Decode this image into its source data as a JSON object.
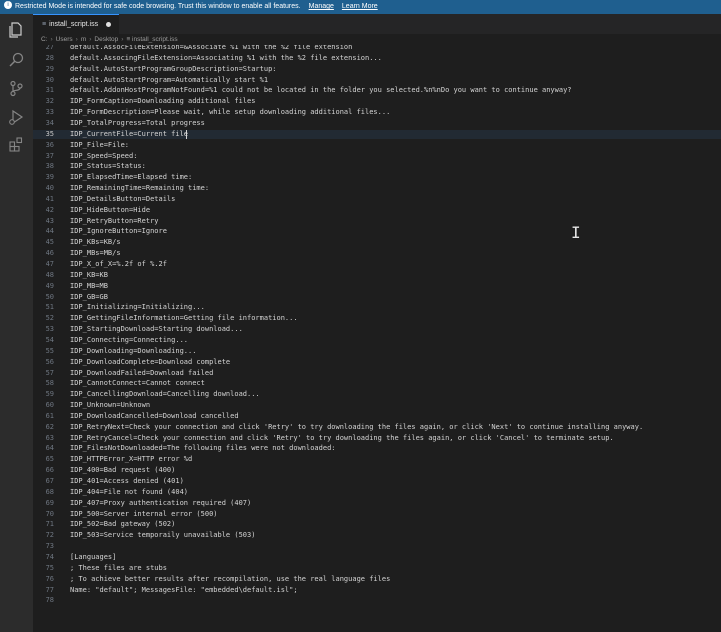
{
  "banner": {
    "message": "Restricted Mode is intended for safe code browsing. Trust this window to enable all features.",
    "manage": "Manage",
    "learn_more": "Learn More"
  },
  "activity_bar": [
    "explorer-icon",
    "search-icon",
    "source-control-icon",
    "run-debug-icon",
    "extensions-icon"
  ],
  "tab": {
    "title": "install_script.iss",
    "icon": "≡"
  },
  "breadcrumb": [
    "C:",
    "Users",
    "m",
    "Desktop",
    "≡ install_script.iss"
  ],
  "editor": {
    "current_line": 35,
    "lines": [
      {
        "n": "27",
        "t": "default.AssocFileExtension=&Associate %1 with the %2 file extension"
      },
      {
        "n": "28",
        "t": "default.AssocingFileExtension=Associating %1 with the %2 file extension..."
      },
      {
        "n": "29",
        "t": "default.AutoStartProgramGroupDescription=Startup:"
      },
      {
        "n": "30",
        "t": "default.AutoStartProgram=Automatically start %1"
      },
      {
        "n": "31",
        "t": "default.AddonHostProgramNotFound=%1 could not be located in the folder you selected.%n%nDo you want to continue anyway?"
      },
      {
        "n": "32",
        "t": "IDP_FormCaption=Downloading additional files"
      },
      {
        "n": "33",
        "t": "IDP_FormDescription=Please wait, while setup downloading additional files..."
      },
      {
        "n": "34",
        "t": "IDP_TotalProgress=Total progress"
      },
      {
        "n": "35",
        "t": "IDP_CurrentFile=Current file"
      },
      {
        "n": "36",
        "t": "IDP_File=File:"
      },
      {
        "n": "37",
        "t": "IDP_Speed=Speed:"
      },
      {
        "n": "38",
        "t": "IDP_Status=Status:"
      },
      {
        "n": "39",
        "t": "IDP_ElapsedTime=Elapsed time:"
      },
      {
        "n": "40",
        "t": "IDP_RemainingTime=Remaining time:"
      },
      {
        "n": "41",
        "t": "IDP_DetailsButton=Details"
      },
      {
        "n": "42",
        "t": "IDP_HideButton=Hide"
      },
      {
        "n": "43",
        "t": "IDP_RetryButton=Retry"
      },
      {
        "n": "44",
        "t": "IDP_IgnoreButton=Ignore"
      },
      {
        "n": "45",
        "t": "IDP_KBs=KB/s"
      },
      {
        "n": "46",
        "t": "IDP_MBs=MB/s"
      },
      {
        "n": "47",
        "t": "IDP_X_of_X=%.2f of %.2f"
      },
      {
        "n": "48",
        "t": "IDP_KB=KB"
      },
      {
        "n": "49",
        "t": "IDP_MB=MB"
      },
      {
        "n": "50",
        "t": "IDP_GB=GB"
      },
      {
        "n": "51",
        "t": "IDP_Initializing=Initializing..."
      },
      {
        "n": "52",
        "t": "IDP_GettingFileInformation=Getting file information..."
      },
      {
        "n": "53",
        "t": "IDP_StartingDownload=Starting download..."
      },
      {
        "n": "54",
        "t": "IDP_Connecting=Connecting..."
      },
      {
        "n": "55",
        "t": "IDP_Downloading=Downloading..."
      },
      {
        "n": "56",
        "t": "IDP_DownloadComplete=Download complete"
      },
      {
        "n": "57",
        "t": "IDP_DownloadFailed=Download failed"
      },
      {
        "n": "58",
        "t": "IDP_CannotConnect=Cannot connect"
      },
      {
        "n": "59",
        "t": "IDP_CancellingDownload=Cancelling download..."
      },
      {
        "n": "60",
        "t": "IDP_Unknown=Unknown"
      },
      {
        "n": "61",
        "t": "IDP_DownloadCancelled=Download cancelled"
      },
      {
        "n": "62",
        "t": "IDP_RetryNext=Check your connection and click 'Retry' to try downloading the files again, or click 'Next' to continue installing anyway."
      },
      {
        "n": "63",
        "t": "IDP_RetryCancel=Check your connection and click 'Retry' to try downloading the files again, or click 'Cancel' to terminate setup."
      },
      {
        "n": "64",
        "t": "IDP_FilesNotDownloaded=The following files were not downloaded:"
      },
      {
        "n": "65",
        "t": "IDP_HTTPError_X=HTTP error %d"
      },
      {
        "n": "66",
        "t": "IDP_400=Bad request (400)"
      },
      {
        "n": "67",
        "t": "IDP_401=Access denied (401)"
      },
      {
        "n": "68",
        "t": "IDP_404=File not found (404)"
      },
      {
        "n": "69",
        "t": "IDP_407=Proxy authentication required (407)"
      },
      {
        "n": "70",
        "t": "IDP_500=Server internal error (500)"
      },
      {
        "n": "71",
        "t": "IDP_502=Bad gateway (502)"
      },
      {
        "n": "72",
        "t": "IDP_503=Service temporaily unavailable (503)"
      },
      {
        "n": "73",
        "t": ""
      },
      {
        "n": "74",
        "t": "[Languages]"
      },
      {
        "n": "75",
        "t": "; These files are stubs"
      },
      {
        "n": "76",
        "t": "; To achieve better results after recompilation, use the real language files"
      },
      {
        "n": "77",
        "t": "Name: \"default\"; MessagesFile: \"embedded\\default.isl\";"
      },
      {
        "n": "78",
        "t": ""
      }
    ]
  },
  "colors": {
    "banner": "#1f5f8f",
    "editor_bg": "#1e1e1e",
    "activity_bar": "#2c2c2c",
    "tab_accent": "#3794ff",
    "text": "#d4d4d4",
    "line_number": "#6e7681"
  }
}
